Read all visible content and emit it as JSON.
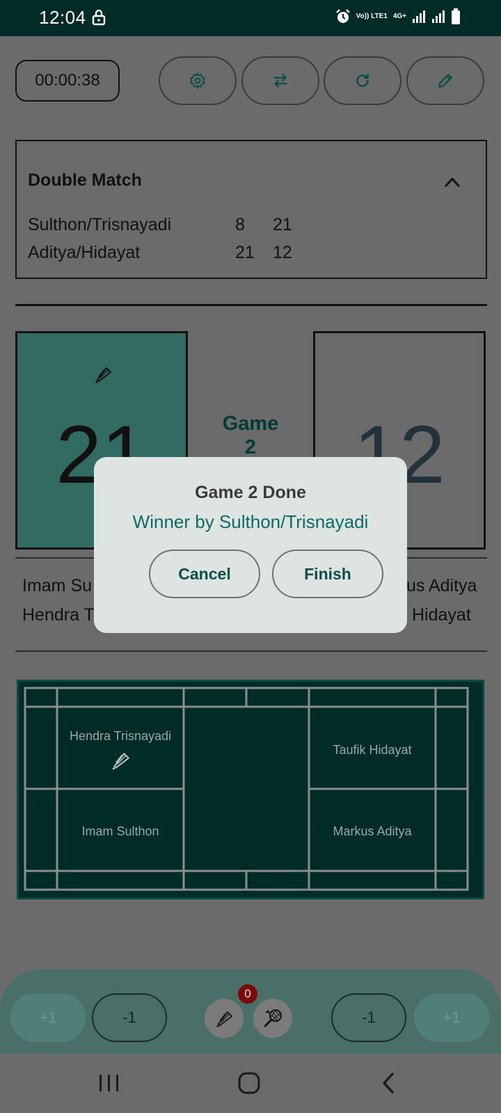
{
  "status_bar": {
    "time": "12:04",
    "network_line1": "Vo)) LTE1",
    "network_line2": "4G+"
  },
  "timer": {
    "value": "00:00:38"
  },
  "controls": [
    {
      "icon": "gear-icon"
    },
    {
      "icon": "swap-icon"
    },
    {
      "icon": "refresh-icon"
    },
    {
      "icon": "pencil-icon"
    }
  ],
  "match": {
    "title": "Double Match",
    "teams": [
      {
        "name": "Sulthon/Trisnayadi",
        "game1": "8",
        "game2": "21"
      },
      {
        "name": "Aditya/Hidayat",
        "game1": "21",
        "game2": "12"
      }
    ]
  },
  "score": {
    "left": "21",
    "right": "12",
    "game_label": "Game",
    "game_number": "2"
  },
  "players": {
    "left_top": "Imam Su",
    "left_bottom": "Hendra T",
    "right_top": "us Aditya",
    "right_bottom": "Hidayat"
  },
  "court": {
    "left_top": "Hendra Trisnayadi",
    "left_bottom": "Imam Sulthon",
    "right_top": "Taufik Hidayat",
    "right_bottom": "Markus Aditya"
  },
  "bottom": {
    "plus_left": "+1",
    "minus_left": "-1",
    "minus_right": "-1",
    "plus_right": "+1",
    "badge": "0"
  },
  "dialog": {
    "title": "Game 2 Done",
    "subtitle": "Winner by Sulthon/Trisnayadi",
    "cancel": "Cancel",
    "finish": "Finish"
  },
  "colors": {
    "status_bar": "#002b26",
    "accent": "#0d6b63",
    "serving_box": "#316b62",
    "court": "#002b26",
    "overlay": "#6b6b6b",
    "dialog_bg": "#dde4e2"
  }
}
